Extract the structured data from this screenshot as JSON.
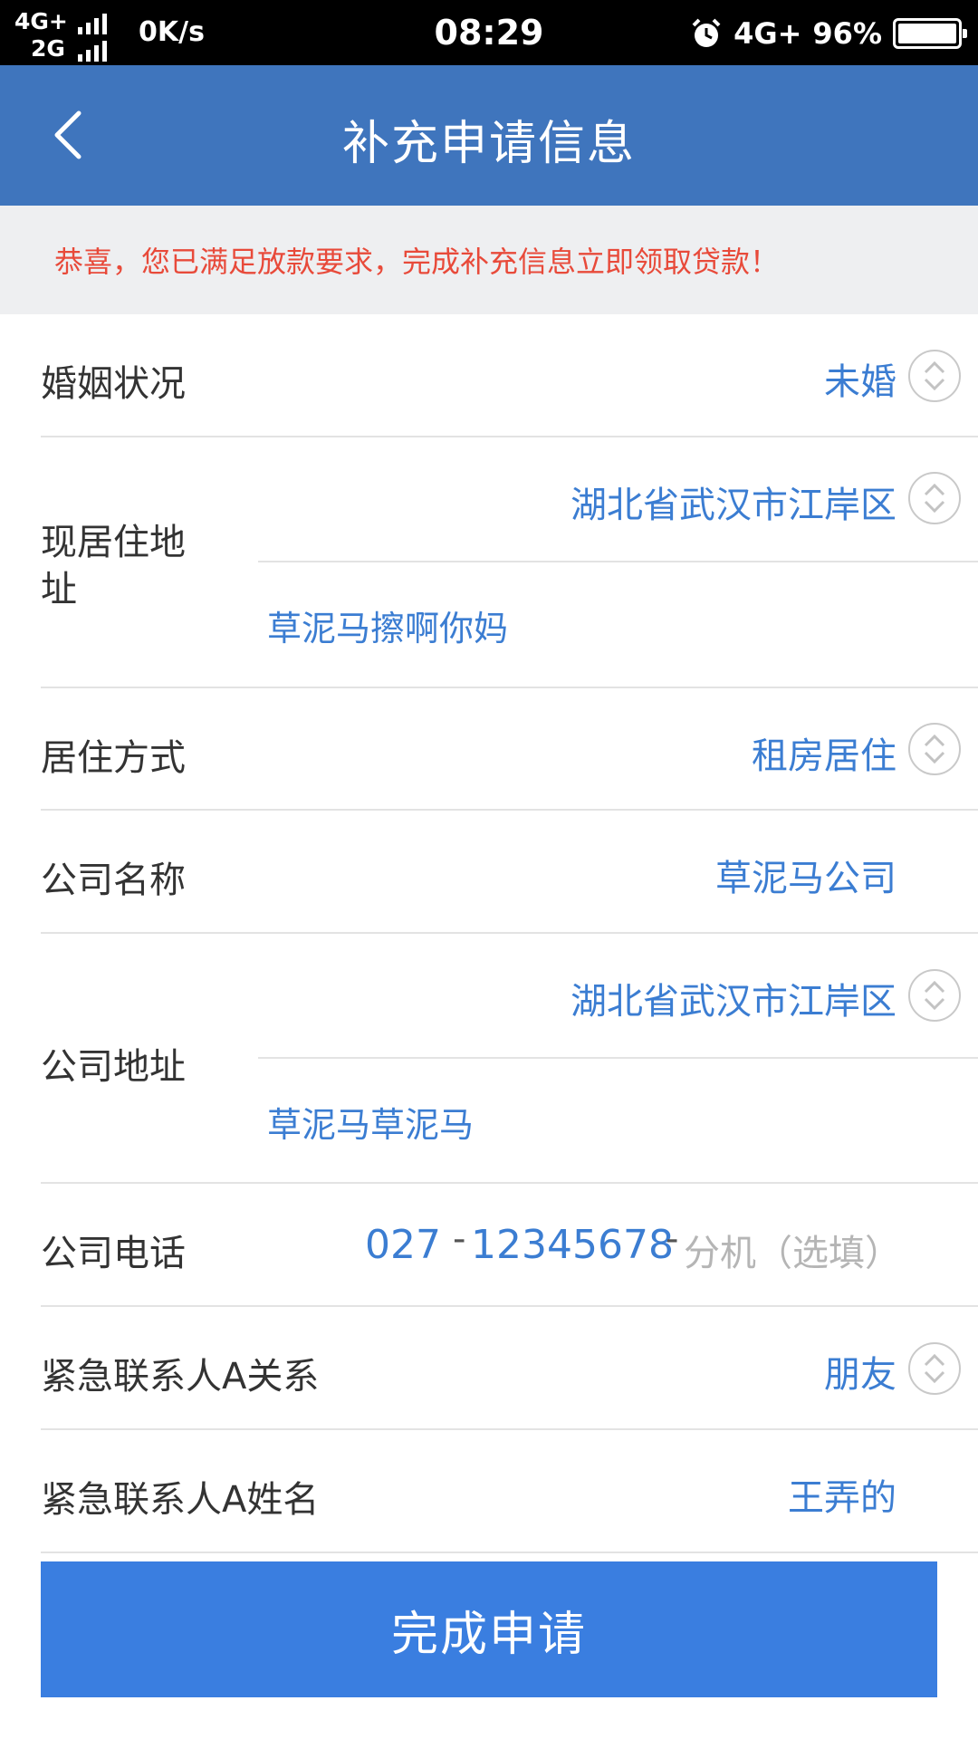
{
  "status_bar": {
    "network_top": "4G+",
    "network_bottom": "2G",
    "speed": "0K/s",
    "time": "08:29",
    "network_right": "4G+",
    "battery": "96%"
  },
  "header": {
    "title": "补充申请信息"
  },
  "notice": {
    "text": "恭喜，您已满足放款要求，完成补充信息立即领取贷款！",
    "color": "#e84a3a"
  },
  "form": {
    "marital_status": {
      "label": "婚姻状况",
      "value": "未婚"
    },
    "current_address": {
      "label": "现居住地址",
      "region": "湖北省武汉市江岸区",
      "detail": "草泥马擦啊你妈"
    },
    "residence_type": {
      "label": "居住方式",
      "value": "租房居住"
    },
    "company_name": {
      "label": "公司名称",
      "value": "草泥马公司"
    },
    "company_address": {
      "label": "公司地址",
      "region": "湖北省武汉市江岸区",
      "detail": "草泥马草泥马"
    },
    "company_phone": {
      "label": "公司电话",
      "area_code": "027",
      "separator": "-",
      "number": "12345678",
      "extension_placeholder": "分机（选填）"
    },
    "contact_a_relation": {
      "label": "紧急联系人A关系",
      "value": "朋友"
    },
    "contact_a_name": {
      "label": "紧急联系人A姓名",
      "value": "王弄的"
    }
  },
  "submit": {
    "label": "完成申请"
  },
  "colors": {
    "header_bg": "#3f75bd",
    "value_text": "#3b7dd2",
    "button_bg": "#3a7ee0"
  }
}
